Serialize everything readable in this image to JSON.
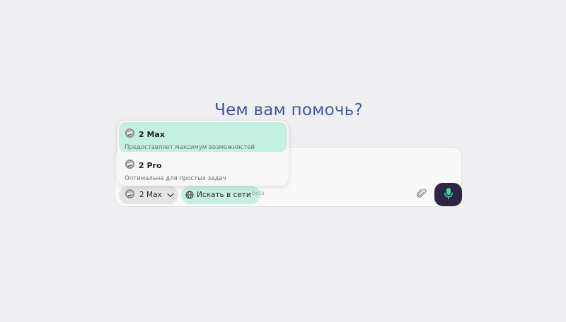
{
  "headline": "Чем вам помочь?",
  "dropdown": {
    "options": [
      {
        "name": "2 Max",
        "description": "Предоставляет максимум возможностей",
        "selected": true
      },
      {
        "name": "2 Pro",
        "description": "Оптимальна для простых задач",
        "selected": false
      }
    ]
  },
  "composer": {
    "model_label": "2 Max",
    "web_search_label": "Искать в сети",
    "web_search_badge": "beta"
  },
  "icons": {
    "model_logo": "model-logo-icon",
    "chevron": "chevron-down-icon",
    "globe": "globe-icon",
    "attach": "paperclip-icon",
    "mic": "microphone-icon"
  },
  "colors": {
    "background": "#efeff1",
    "selected_option": "#c4f0e2",
    "web_search_chip": "#c7eee2",
    "mic_button": "#2e2640",
    "mic_icon": "#3ed7a3",
    "headline_gradient_start": "#5a2ea6",
    "headline_gradient_end": "#2f86a3"
  }
}
